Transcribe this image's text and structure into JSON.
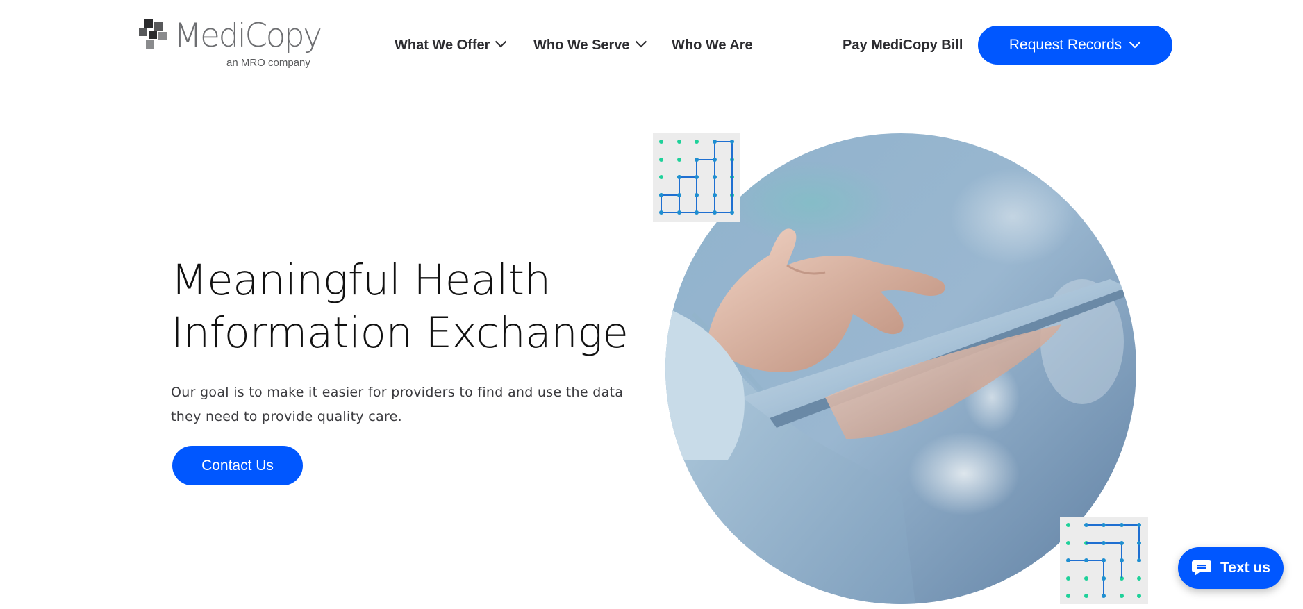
{
  "brand": {
    "name": "MediCopy",
    "tagline": "an MRO company"
  },
  "nav": {
    "items": [
      {
        "label": "What We Offer",
        "has_dropdown": true
      },
      {
        "label": "Who We Serve",
        "has_dropdown": true
      },
      {
        "label": "Who We Are",
        "has_dropdown": false
      }
    ],
    "pay_label": "Pay MediCopy Bill",
    "request_label": "Request Records"
  },
  "hero": {
    "title_line1": "Meaningful Health",
    "title_line2": "Information Exchange",
    "subtitle_line1": "Our goal is to make it easier for providers to find and use the data",
    "subtitle_line2": "they need to provide quality care.",
    "cta_label": "Contact Us"
  },
  "chat": {
    "label": "Text us"
  },
  "colors": {
    "accent": "#0057ff",
    "grid_dot": "#1fd19a",
    "grid_line": "#1f6fd1",
    "grid_bg": "#ececec"
  },
  "icons": {
    "logo": "medicopy-logo-icon",
    "dropdown": "chevron-down-icon",
    "chat": "chat-bubble-icon"
  }
}
